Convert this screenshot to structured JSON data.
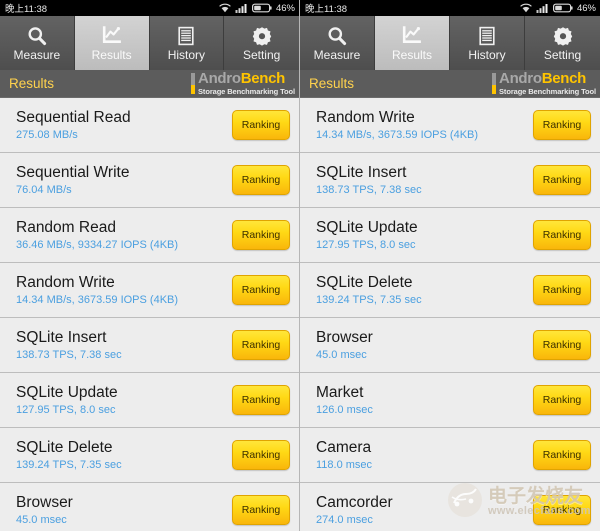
{
  "status_bar": {
    "time": "晚上11:38",
    "battery_percent": "46%",
    "icons": [
      "wifi-icon",
      "signal-icon",
      "battery-icon"
    ]
  },
  "tabs": [
    {
      "label": "Measure",
      "icon": "magnifier-icon",
      "active": false
    },
    {
      "label": "Results",
      "icon": "chart-icon",
      "active": true
    },
    {
      "label": "History",
      "icon": "list-lines-icon",
      "active": false
    },
    {
      "label": "Setting",
      "icon": "gear-icon",
      "active": false
    }
  ],
  "titlebar": {
    "title": "Results",
    "brand_part1": "Andro",
    "brand_part2": "Bench",
    "brand_tagline": "Storage Benchmarking Tool"
  },
  "button_label": "Ranking",
  "colors": {
    "accent_yellow": "#ffc400",
    "value_blue": "#4a9fe0",
    "titlebar_gray": "#5c5c5c",
    "list_bg": "#ededed",
    "tab_active": "#cccccc"
  },
  "left_panel": {
    "rows": [
      {
        "name": "Sequential Read",
        "value": "275.08 MB/s"
      },
      {
        "name": "Sequential Write",
        "value": "76.04 MB/s"
      },
      {
        "name": "Random Read",
        "value": "36.46 MB/s, 9334.27 IOPS (4KB)"
      },
      {
        "name": "Random Write",
        "value": "14.34 MB/s, 3673.59 IOPS (4KB)"
      },
      {
        "name": "SQLite Insert",
        "value": "138.73 TPS, 7.38 sec"
      },
      {
        "name": "SQLite Update",
        "value": "127.95 TPS, 8.0 sec"
      },
      {
        "name": "SQLite Delete",
        "value": "139.24 TPS, 7.35 sec"
      },
      {
        "name": "Browser",
        "value": "45.0 msec"
      }
    ]
  },
  "right_panel": {
    "rows": [
      {
        "name": "Random Write",
        "value": "14.34 MB/s, 3673.59 IOPS (4KB)"
      },
      {
        "name": "SQLite Insert",
        "value": "138.73 TPS, 7.38 sec"
      },
      {
        "name": "SQLite Update",
        "value": "127.95 TPS, 8.0 sec"
      },
      {
        "name": "SQLite Delete",
        "value": "139.24 TPS, 7.35 sec"
      },
      {
        "name": "Browser",
        "value": "45.0 msec"
      },
      {
        "name": "Market",
        "value": "126.0 msec"
      },
      {
        "name": "Camera",
        "value": "118.0 msec"
      },
      {
        "name": "Camcorder",
        "value": "274.0 msec"
      }
    ]
  },
  "watermark": {
    "text_cn": "电子发烧友",
    "url": "www.elecfans.com"
  }
}
